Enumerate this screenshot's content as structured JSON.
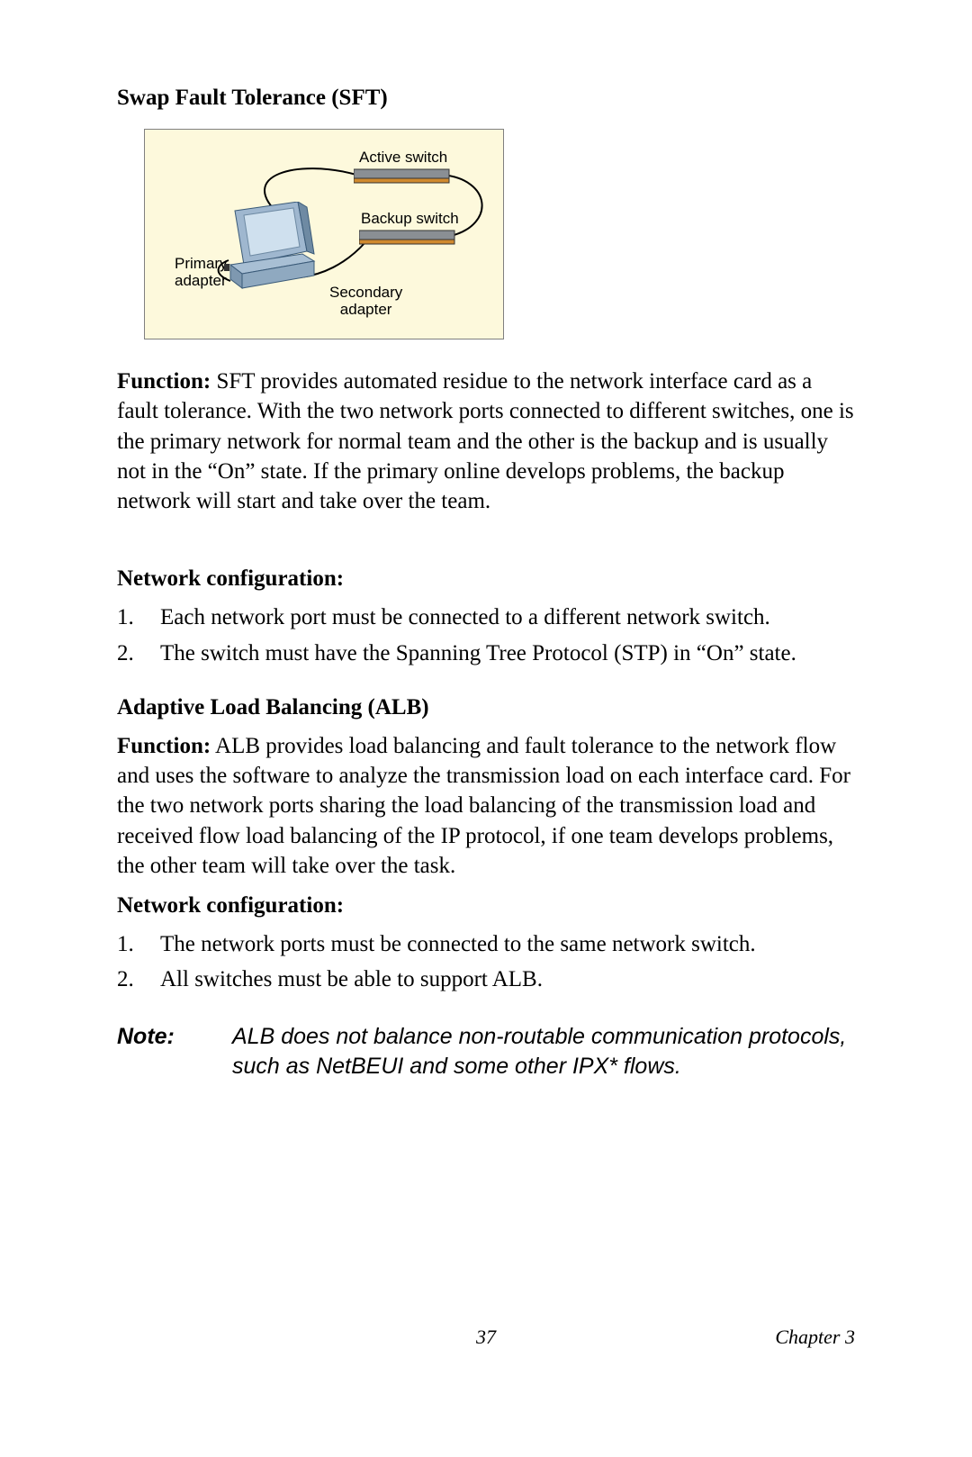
{
  "sft": {
    "heading": "Swap Fault Tolerance (SFT)",
    "diagram": {
      "active_switch": "Active switch",
      "backup_switch": "Backup switch",
      "primary_adapter_l1": "Primary",
      "primary_adapter_l2": "adapter",
      "secondary_adapter_l1": "Secondary",
      "secondary_adapter_l2": "adapter"
    },
    "function_label": "Function:",
    "function_body": " SFT provides automated residue to the network interface card as a fault tolerance. With the two network ports connected to different switches, one is the primary network for normal team and the other is the backup and is usually not in the “On” state. If the primary online develops problems, the backup network will start and take over the team.",
    "netconf_heading": "Network configuration:",
    "items": [
      "Each network port must be connected to a different network switch.",
      "The switch must have the Spanning Tree Protocol (STP) in “On” state."
    ]
  },
  "alb": {
    "heading": "Adaptive Load Balancing (ALB)",
    "function_label": "Function:",
    "function_body": " ALB provides load balancing and fault tolerance to the network flow and uses the software to analyze the transmission load on each interface card. For the two network ports sharing the load balancing of the transmission load and received flow load balancing of the IP protocol, if one team develops problems, the other team will take over the task.",
    "netconf_heading": "Network configuration:",
    "items": [
      "The network ports must be connected to the same network switch.",
      "All switches must be able to support ALB."
    ],
    "note_label": "Note:",
    "note_body": "ALB does not balance non-routable communication protocols, such as NetBEUI and some other IPX* flows."
  },
  "footer": {
    "page": "37",
    "chapter": "Chapter 3"
  },
  "ordinals": {
    "n1": "1.",
    "n2": "2."
  }
}
